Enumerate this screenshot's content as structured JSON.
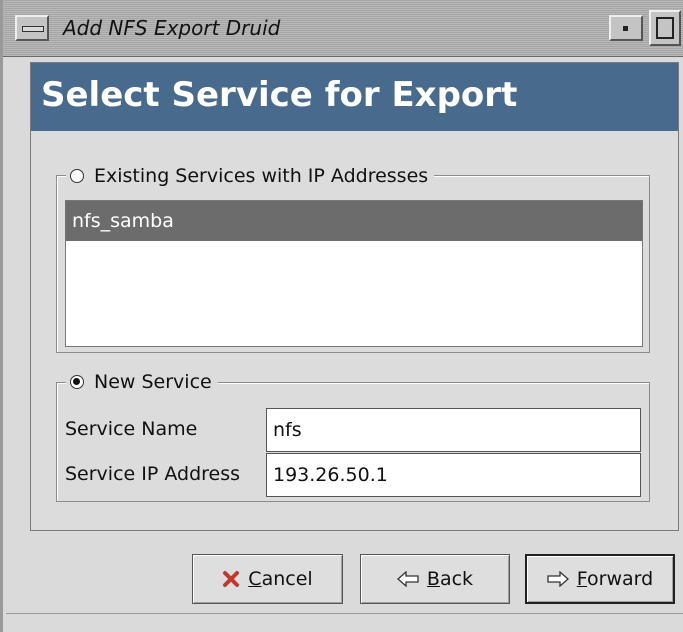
{
  "window": {
    "title": "Add NFS Export Druid"
  },
  "header": {
    "title": "Select Service for Export"
  },
  "existing": {
    "label": "Existing Services with IP Addresses",
    "selected": false,
    "items": [
      "nfs_samba"
    ]
  },
  "new_service": {
    "label": "New Service",
    "selected": true,
    "name_label": "Service Name",
    "name_value": "nfs",
    "ip_label": "Service IP Address",
    "ip_value": "193.26.50.1"
  },
  "buttons": {
    "cancel": {
      "mnemonic": "C",
      "rest": "ancel",
      "icon": "x-icon"
    },
    "back": {
      "mnemonic": "B",
      "rest": "ack",
      "icon": "left-arrow-icon"
    },
    "forward": {
      "mnemonic": "F",
      "rest": "orward",
      "icon": "right-arrow-icon"
    }
  },
  "colors": {
    "header_bg": "#486a8c",
    "selected_row": "#6c6c6c",
    "cancel_icon": "#c0392b",
    "arrow_icon": "#5aa02c"
  }
}
